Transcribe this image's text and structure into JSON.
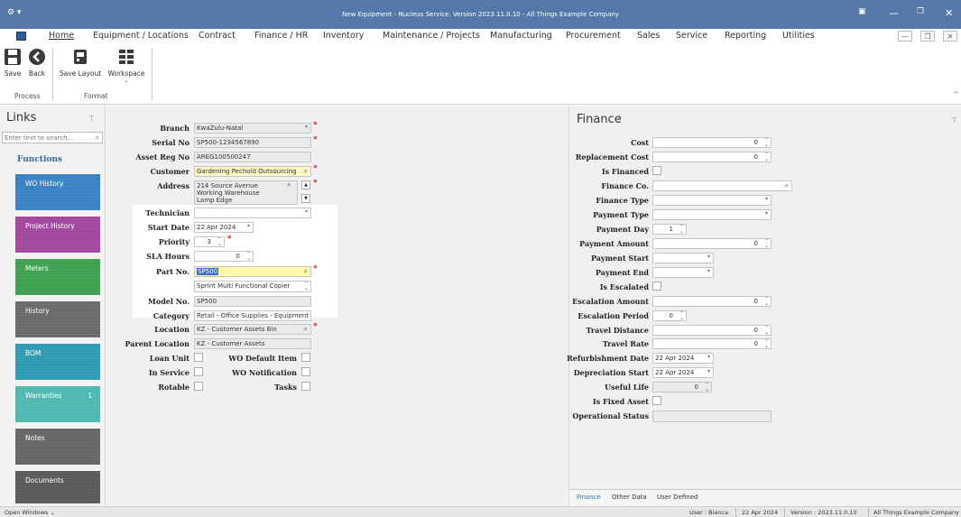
{
  "window": {
    "title": "New Equipment - Nucleus Service: Version 2023.11.0.10 - All Things Example Company"
  },
  "menu": {
    "tabs": [
      "Home",
      "Equipment / Locations",
      "Contract",
      "Finance / HR",
      "Inventory",
      "Maintenance / Projects",
      "Manufacturing",
      "Procurement",
      "Sales",
      "Service",
      "Reporting",
      "Utilities"
    ]
  },
  "ribbon": {
    "buttons": {
      "save": "Save",
      "back": "Back",
      "save_layout": "Save Layout",
      "workspace": "Workspace"
    },
    "groups": {
      "process": "Process",
      "format": "Format"
    }
  },
  "links": {
    "title": "Links",
    "search_placeholder": "Enter text to search...",
    "functions_label": "Functions",
    "tiles": [
      {
        "label": "WO History",
        "color": "#3a82c4"
      },
      {
        "label": "Project History",
        "color": "#a1489d"
      },
      {
        "label": "Meters",
        "color": "#3fa150"
      },
      {
        "label": "History",
        "color": "#6a6a6a"
      },
      {
        "label": "BOM",
        "color": "#2e9ab3"
      },
      {
        "label": "Warranties",
        "color": "#4fb8b0",
        "count": "1"
      },
      {
        "label": "Notes",
        "color": "#666666"
      },
      {
        "label": "Documents",
        "color": "#5a5a5a"
      }
    ]
  },
  "form": {
    "branch": {
      "label": "Branch",
      "value": "KwaZulu-Natal"
    },
    "serial_no": {
      "label": "Serial No",
      "value": "SP500-1234567890"
    },
    "asset_reg_no": {
      "label": "Asset Reg No",
      "value": "AREG100500247"
    },
    "customer": {
      "label": "Customer",
      "value": "Gardening Pechold Outsourcing"
    },
    "address": {
      "label": "Address",
      "lines": [
        "214 Source Avenue",
        "Working Warehouse",
        "Lamp Edge"
      ]
    },
    "technician": {
      "label": "Technician",
      "value": ""
    },
    "start_date": {
      "label": "Start Date",
      "value": "22 Apr 2024"
    },
    "priority": {
      "label": "Priority",
      "value": "3"
    },
    "sla_hours": {
      "label": "SLA Hours",
      "value": "0"
    },
    "part_no": {
      "label": "Part No.",
      "value": "SP500",
      "description": "Sprint Multi Functional Copier"
    },
    "model_no": {
      "label": "Model No.",
      "value": "SP500"
    },
    "category": {
      "label": "Category",
      "value": "Retail - Office Supplies - Equipment"
    },
    "location": {
      "label": "Location",
      "value": "KZ - Customer Assets Bin"
    },
    "parent_location": {
      "label": "Parent Location",
      "value": "KZ - Customer Assets"
    },
    "loan_unit": {
      "label": "Loan Unit"
    },
    "wo_default_item": {
      "label": "WO Default Item"
    },
    "in_service": {
      "label": "In Service"
    },
    "wo_notification": {
      "label": "WO Notification"
    },
    "rotable": {
      "label": "Rotable"
    },
    "tasks": {
      "label": "Tasks"
    }
  },
  "finance": {
    "title": "Finance",
    "cost": {
      "label": "Cost",
      "value": "0"
    },
    "replacement_cost": {
      "label": "Replacement Cost",
      "value": "0"
    },
    "is_financed": {
      "label": "Is Financed"
    },
    "finance_co": {
      "label": "Finance Co."
    },
    "finance_type": {
      "label": "Finance Type"
    },
    "payment_type": {
      "label": "Payment Type"
    },
    "payment_day": {
      "label": "Payment Day",
      "value": "1"
    },
    "payment_amount": {
      "label": "Payment Amount",
      "value": "0"
    },
    "payment_start": {
      "label": "Payment Start"
    },
    "payment_end": {
      "label": "Payment End"
    },
    "is_escalated": {
      "label": "Is Escalated"
    },
    "escalation_amount": {
      "label": "Escalation Amount",
      "value": "0"
    },
    "escalation_period": {
      "label": "Escalation Period",
      "value": "0"
    },
    "travel_distance": {
      "label": "Travel Distance",
      "value": "0"
    },
    "travel_rate": {
      "label": "Travel Rate",
      "value": "0"
    },
    "refurbishment_date": {
      "label": "Refurbishment Date",
      "value": "22 Apr 2024"
    },
    "depreciation_start": {
      "label": "Depreciation Start",
      "value": "22 Apr 2024"
    },
    "useful_life": {
      "label": "Useful Life",
      "value": "0"
    },
    "is_fixed_asset": {
      "label": "Is Fixed Asset"
    },
    "operational_status": {
      "label": "Operational Status"
    },
    "tabs": [
      "Finance",
      "Other Data",
      "User Defined"
    ]
  },
  "status": {
    "open_windows": "Open Windows",
    "user": "User : Bianca",
    "date": "22 Apr 2024",
    "version": "Version : 2023.11.0.10",
    "company": "All Things Example Company"
  }
}
